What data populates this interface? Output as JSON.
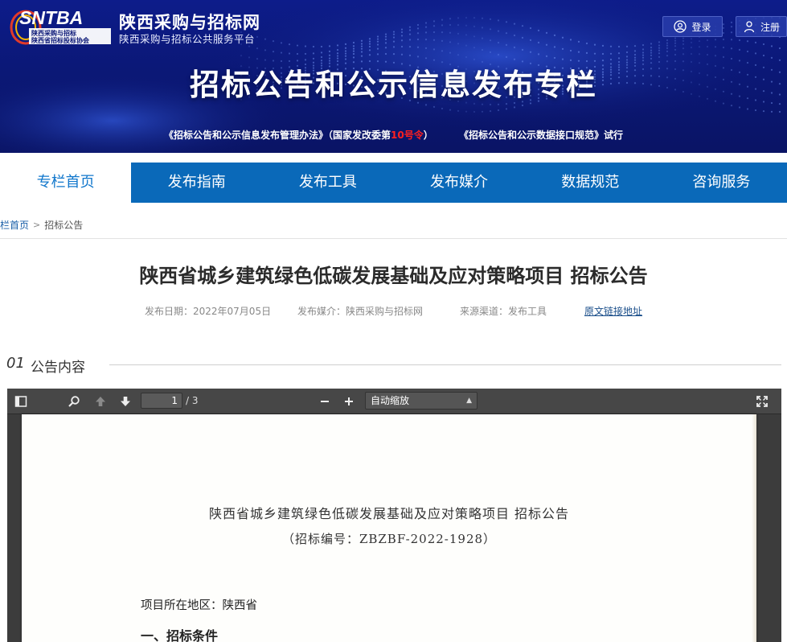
{
  "banner": {
    "logo_text": "SNTBA",
    "logo_sub1": "陕西采购与招标",
    "logo_sub2": "陕西省招标投标协会",
    "site_title": "陕西采购与招标网",
    "site_subtitle": "陕西采购与招标公共服务平台",
    "login_label": "登录",
    "register_label": "注册",
    "heading": "招标公告和公示信息发布专栏",
    "policy_link_1_prefix": "《招标公告和公示信息发布管理办法》（国家发改委第",
    "policy_link_1_highlight": "10号令",
    "policy_link_1_suffix": "）",
    "policy_link_2": "《招标公告和公示数据接口规范》试行",
    "highlight_color": "#ff2020"
  },
  "nav": {
    "items": [
      {
        "label": "专栏首页"
      },
      {
        "label": "发布指南"
      },
      {
        "label": "发布工具"
      },
      {
        "label": "发布媒介"
      },
      {
        "label": "数据规范"
      },
      {
        "label": "咨询服务"
      }
    ],
    "active_index": 0,
    "background": "#0a69b9"
  },
  "breadcrumb": {
    "home": "栏首页",
    "current": "招标公告"
  },
  "article": {
    "title": "陕西省城乡建筑绿色低碳发展基础及应对策略项目 招标公告",
    "publish_date": "发布日期：2022年07月05日",
    "media": "发布媒介：陕西采购与招标网",
    "source": "来源渠道：发布工具",
    "original_link": "原文链接地址"
  },
  "section": {
    "number": "01",
    "label": "公告内容"
  },
  "pdf_viewer": {
    "current_page": "1",
    "total_pages": "/ 3",
    "zoom_mode": "自动缩放",
    "document": {
      "title": "陕西省城乡建筑绿色低碳发展基础及应对策略项目 招标公告",
      "number": "（招标编号：ZBZBF-2022-1928）",
      "region": "项目所在地区：陕西省",
      "section_heading": "一、招标条件"
    }
  }
}
